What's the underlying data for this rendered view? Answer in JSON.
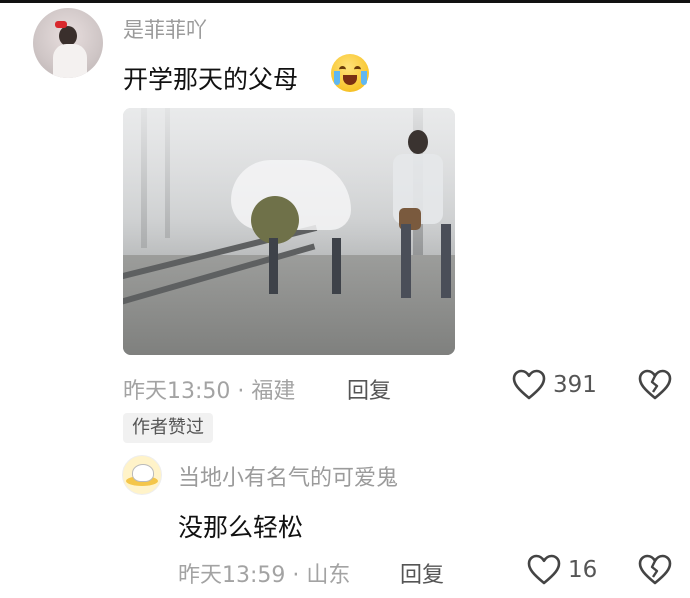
{
  "comment": {
    "username": "是菲菲吖",
    "text": "开学那天的父母",
    "emoji": "loudly-crying-face",
    "time_location": "昨天13:50 · 福建",
    "reply_label": "回复",
    "likes": "391",
    "author_liked_tag": "作者赞过"
  },
  "reply": {
    "username": "当地小有名气的可爱鬼",
    "text": "没那么轻松",
    "time_location": "昨天13:59 · 山东",
    "reply_label": "回复",
    "likes": "16"
  }
}
